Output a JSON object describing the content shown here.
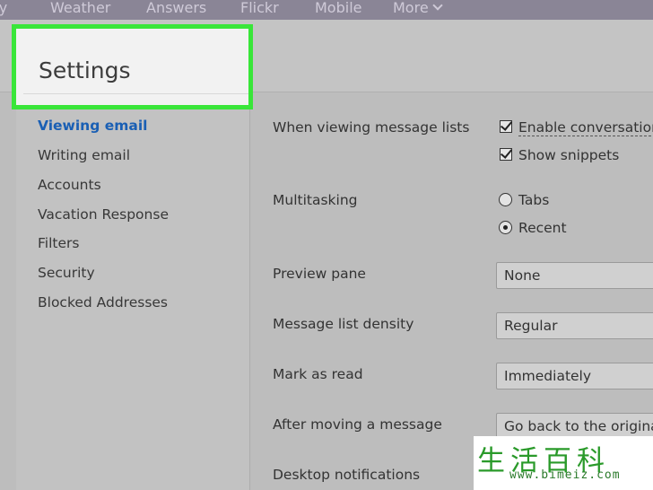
{
  "topnav": {
    "items": [
      "ity",
      "Weather",
      "Answers",
      "Flickr",
      "Mobile",
      "More"
    ]
  },
  "settings": {
    "title": "Settings"
  },
  "sidebar": {
    "items": [
      {
        "label": "Viewing email",
        "active": true
      },
      {
        "label": "Writing email"
      },
      {
        "label": "Accounts"
      },
      {
        "label": "Vacation Response"
      },
      {
        "label": "Filters"
      },
      {
        "label": "Security"
      },
      {
        "label": "Blocked Addresses"
      }
    ]
  },
  "main": {
    "message_lists": {
      "label": "When viewing message lists",
      "enable_conversation": "Enable conversation",
      "show_snippets": "Show snippets"
    },
    "multitasking": {
      "label": "Multitasking",
      "tabs": "Tabs",
      "recent": "Recent"
    },
    "preview_pane": {
      "label": "Preview pane",
      "value": "None"
    },
    "density": {
      "label": "Message list density",
      "value": "Regular"
    },
    "mark_as_read": {
      "label": "Mark as read",
      "value": "Immediately"
    },
    "after_moving": {
      "label": "After moving a message",
      "value": "Go back to the original"
    },
    "desktop_notifications": {
      "label": "Desktop notifications"
    }
  },
  "watermark": {
    "logo": "生活百科",
    "url": "www.bimeiz.com"
  },
  "colors": {
    "highlight": "#39e639",
    "active_link": "#1a5fb4"
  }
}
